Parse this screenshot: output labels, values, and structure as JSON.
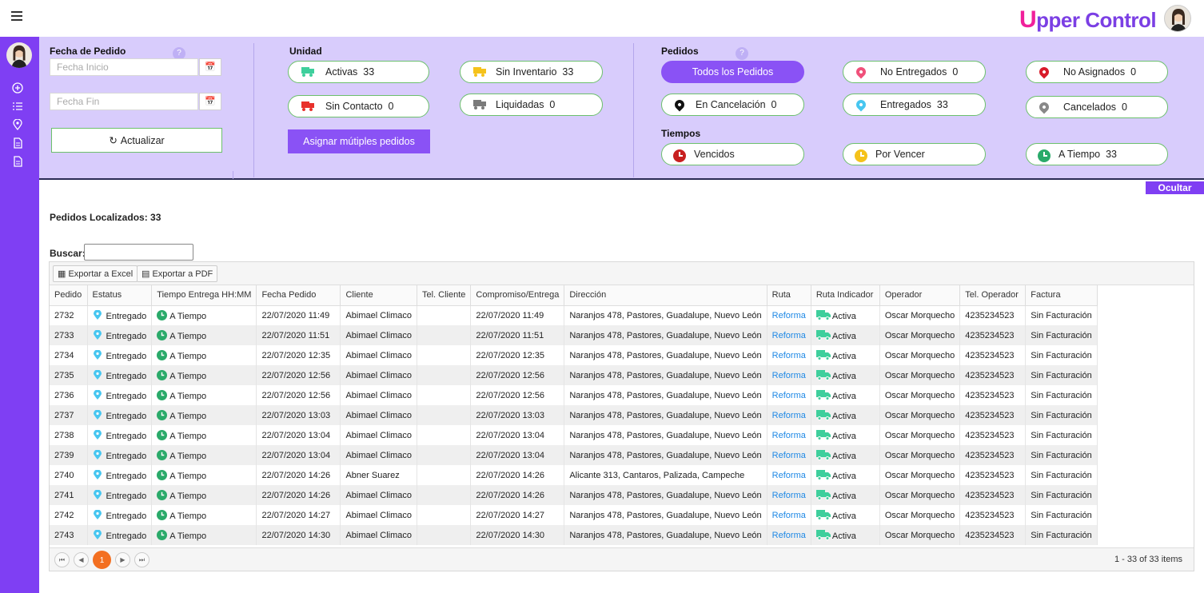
{
  "brand": {
    "first": "U",
    "rest": "pper Control"
  },
  "filters": {
    "fecha_label": "Fecha de Pedido",
    "help": "?",
    "fecha_inicio_placeholder": "Fecha Inicio",
    "fecha_fin_placeholder": "Fecha Fin",
    "actualizar": "Actualizar",
    "unidad_label": "Unidad",
    "asignar": "Asignar mútiples pedidos",
    "pedidos_label": "Pedidos",
    "tiempos_label": "Tiempos"
  },
  "unidad": [
    {
      "label": "Activas",
      "count": "33",
      "color": "#3ecf9c"
    },
    {
      "label": "Sin Inventario",
      "count": "33",
      "color": "#f5c21b"
    },
    {
      "label": "Sin Contacto",
      "count": "0",
      "color": "#e8302b"
    },
    {
      "label": "Liquidadas",
      "count": "0",
      "color": "#7a7a7a"
    }
  ],
  "pedidos": {
    "todos": "Todos los Pedidos",
    "items": [
      {
        "label": "No Entregados",
        "count": "0",
        "color": "#f0507a"
      },
      {
        "label": "No Asignados",
        "count": "0",
        "color": "#d81b2a"
      },
      {
        "label": "En Cancelación",
        "count": "0",
        "color": "#111111"
      },
      {
        "label": "Entregados",
        "count": "33",
        "color": "#47c6f0"
      },
      {
        "label": "Cancelados",
        "count": "0",
        "color": "#888888"
      }
    ]
  },
  "tiempos": [
    {
      "label": "Vencidos",
      "count": "",
      "color": "#c82020"
    },
    {
      "label": "Por Vencer",
      "count": "",
      "color": "#f5c21b"
    },
    {
      "label": "A Tiempo",
      "count": "33",
      "color": "#2aaa6a"
    }
  ],
  "ocultar": "Ocultar",
  "found": "Pedidos Localizados: 33",
  "buscar": "Buscar:",
  "export_excel": "Exportar a Excel",
  "export_pdf": "Exportar a PDF",
  "columns": [
    "Pedido",
    "Estatus",
    "Tiempo Entrega HH:MM",
    "Fecha Pedido",
    "Cliente",
    "Tel. Cliente",
    "Compromiso/Entrega",
    "Dirección",
    "Ruta",
    "Ruta Indicador",
    "Operador",
    "Tel. Operador",
    "Factura"
  ],
  "rows": [
    [
      "2732",
      "Entregado",
      "A Tiempo",
      "22/07/2020 11:49",
      "Abimael Climaco",
      "",
      "22/07/2020 11:49",
      "Naranjos 478, Pastores, Guadalupe, Nuevo León",
      "Reforma",
      "Activa",
      "Oscar Morquecho",
      "4235234523",
      "Sin Facturación"
    ],
    [
      "2733",
      "Entregado",
      "A Tiempo",
      "22/07/2020 11:51",
      "Abimael Climaco",
      "",
      "22/07/2020 11:51",
      "Naranjos 478, Pastores, Guadalupe, Nuevo León",
      "Reforma",
      "Activa",
      "Oscar Morquecho",
      "4235234523",
      "Sin Facturación"
    ],
    [
      "2734",
      "Entregado",
      "A Tiempo",
      "22/07/2020 12:35",
      "Abimael Climaco",
      "",
      "22/07/2020 12:35",
      "Naranjos 478, Pastores, Guadalupe, Nuevo León",
      "Reforma",
      "Activa",
      "Oscar Morquecho",
      "4235234523",
      "Sin Facturación"
    ],
    [
      "2735",
      "Entregado",
      "A Tiempo",
      "22/07/2020 12:56",
      "Abimael Climaco",
      "",
      "22/07/2020 12:56",
      "Naranjos 478, Pastores, Guadalupe, Nuevo León",
      "Reforma",
      "Activa",
      "Oscar Morquecho",
      "4235234523",
      "Sin Facturación"
    ],
    [
      "2736",
      "Entregado",
      "A Tiempo",
      "22/07/2020 12:56",
      "Abimael Climaco",
      "",
      "22/07/2020 12:56",
      "Naranjos 478, Pastores, Guadalupe, Nuevo León",
      "Reforma",
      "Activa",
      "Oscar Morquecho",
      "4235234523",
      "Sin Facturación"
    ],
    [
      "2737",
      "Entregado",
      "A Tiempo",
      "22/07/2020 13:03",
      "Abimael Climaco",
      "",
      "22/07/2020 13:03",
      "Naranjos 478, Pastores, Guadalupe, Nuevo León",
      "Reforma",
      "Activa",
      "Oscar Morquecho",
      "4235234523",
      "Sin Facturación"
    ],
    [
      "2738",
      "Entregado",
      "A Tiempo",
      "22/07/2020 13:04",
      "Abimael Climaco",
      "",
      "22/07/2020 13:04",
      "Naranjos 478, Pastores, Guadalupe, Nuevo León",
      "Reforma",
      "Activa",
      "Oscar Morquecho",
      "4235234523",
      "Sin Facturación"
    ],
    [
      "2739",
      "Entregado",
      "A Tiempo",
      "22/07/2020 13:04",
      "Abimael Climaco",
      "",
      "22/07/2020 13:04",
      "Naranjos 478, Pastores, Guadalupe, Nuevo León",
      "Reforma",
      "Activa",
      "Oscar Morquecho",
      "4235234523",
      "Sin Facturación"
    ],
    [
      "2740",
      "Entregado",
      "A Tiempo",
      "22/07/2020 14:26",
      "Abner Suarez",
      "",
      "22/07/2020 14:26",
      "Alicante 313, Cantaros, Palizada, Campeche",
      "Reforma",
      "Activa",
      "Oscar Morquecho",
      "4235234523",
      "Sin Facturación"
    ],
    [
      "2741",
      "Entregado",
      "A Tiempo",
      "22/07/2020 14:26",
      "Abimael Climaco",
      "",
      "22/07/2020 14:26",
      "Naranjos 478, Pastores, Guadalupe, Nuevo León",
      "Reforma",
      "Activa",
      "Oscar Morquecho",
      "4235234523",
      "Sin Facturación"
    ],
    [
      "2742",
      "Entregado",
      "A Tiempo",
      "22/07/2020 14:27",
      "Abimael Climaco",
      "",
      "22/07/2020 14:27",
      "Naranjos 478, Pastores, Guadalupe, Nuevo León",
      "Reforma",
      "Activa",
      "Oscar Morquecho",
      "4235234523",
      "Sin Facturación"
    ],
    [
      "2743",
      "Entregado",
      "A Tiempo",
      "22/07/2020 14:30",
      "Abimael Climaco",
      "",
      "22/07/2020 14:30",
      "Naranjos 478, Pastores, Guadalupe, Nuevo León",
      "Reforma",
      "Activa",
      "Oscar Morquecho",
      "4235234523",
      "Sin Facturación"
    ]
  ],
  "pager": {
    "current": "1",
    "summary": "1 - 33 of 33 items"
  },
  "icons": {
    "status": "map-pin-icon",
    "time": "clock-icon",
    "route": "truck-icon"
  }
}
